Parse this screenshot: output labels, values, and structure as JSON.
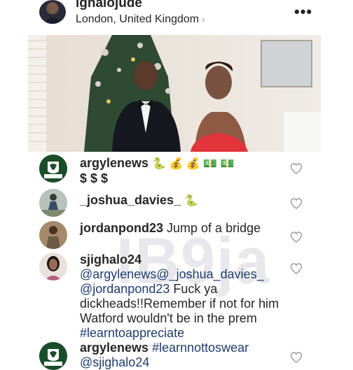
{
  "post": {
    "username": "ighalojude",
    "location": "London, United Kingdom",
    "location_chevron": "›",
    "more_icon": "•••"
  },
  "watermark": "IB9ja",
  "comments": [
    {
      "username": "argylenews",
      "emojis": "🐍 💰 💰 💵 💵",
      "text": "$ $ $",
      "avatar": "argylenews-logo"
    },
    {
      "username": "_joshua_davies_",
      "emojis": "🐍",
      "avatar": "photo"
    },
    {
      "username": "jordanpond23",
      "text": "Jump of a bridge",
      "avatar": "photo"
    },
    {
      "username": "sjighalo24",
      "mention1": "@argylenews",
      "mention2": "@_joshua_davies_",
      "mention3": "@jordanpond23",
      "text": "Fuck ya dickheads!!Remember if not for him Watford wouldn't be in the prem",
      "hashtag": "#learntoappreciate",
      "avatar": "photo"
    },
    {
      "username": "argylenews",
      "hashtag": "#learnnottoswear",
      "mention": "@sjighalo24",
      "avatar": "argylenews-logo"
    }
  ],
  "colors": {
    "link": "#1f3b6f",
    "text": "#262626",
    "heart": "#9a9a9a",
    "argyle_green": "#1a4d2a"
  }
}
